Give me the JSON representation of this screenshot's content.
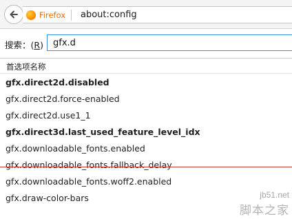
{
  "browser": {
    "brand": "Firefox",
    "url": "about:config",
    "back_icon": "back-arrow-icon",
    "logo_icon": "firefox-logo-icon"
  },
  "search": {
    "label_prefix": "搜索：(",
    "label_mnemonic": "R",
    "label_suffix": ")",
    "value": "gfx.d"
  },
  "table": {
    "column_header": "首选项名称",
    "rows": [
      {
        "name": "gfx.direct2d.disabled",
        "modified": true
      },
      {
        "name": "gfx.direct2d.force-enabled",
        "modified": false
      },
      {
        "name": "gfx.direct2d.use1_1",
        "modified": false
      },
      {
        "name": "gfx.direct3d.last_used_feature_level_idx",
        "modified": true
      },
      {
        "name": "gfx.downloadable_fonts.enabled",
        "modified": false
      },
      {
        "name": "gfx.downloadable_fonts.fallback_delay",
        "modified": false
      },
      {
        "name": "gfx.downloadable_fonts.woff2.enabled",
        "modified": false
      },
      {
        "name": "gfx.draw-color-bars",
        "modified": false
      }
    ]
  },
  "watermark": {
    "url": "jb51.net",
    "name": "脚本之家"
  },
  "colors": {
    "brand": "#ef6c00",
    "focus_border": "#3a8fd9",
    "divider": "#c0392b"
  }
}
